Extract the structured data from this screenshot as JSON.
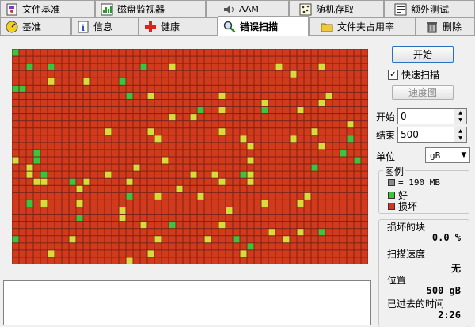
{
  "tabs_row1": [
    {
      "label": "文件基准",
      "icon": "file-benchmark-icon"
    },
    {
      "label": "磁盘监视器",
      "icon": "disk-monitor-icon"
    },
    {
      "label": "AAM",
      "icon": "speaker-icon"
    },
    {
      "label": "随机存取",
      "icon": "random-access-icon"
    },
    {
      "label": "额外测试",
      "icon": "extra-tests-icon"
    }
  ],
  "tabs_row2": [
    {
      "label": "基准",
      "icon": "benchmark-icon"
    },
    {
      "label": "信息",
      "icon": "info-icon"
    },
    {
      "label": "健康",
      "icon": "health-cross-icon"
    },
    {
      "label": "错误扫描",
      "icon": "magnifier-icon",
      "active": true
    },
    {
      "label": "文件夹占用率",
      "icon": "folder-icon"
    },
    {
      "label": "删除",
      "icon": "trash-icon"
    }
  ],
  "controls": {
    "start_label": "开始",
    "quick_scan_label": "快速扫描",
    "quick_scan_checked": true,
    "speed_map_label": "速度图",
    "start_pos_label": "开始",
    "start_pos_value": "0",
    "end_pos_label": "结束",
    "end_pos_value": "500",
    "unit_label": "单位",
    "unit_value": "gB"
  },
  "legend": {
    "title": "图例",
    "block_text": "= 190 MB",
    "good": "好",
    "bad": "损坏"
  },
  "stats": {
    "damaged_blocks_label": "损坏的块",
    "damaged_blocks_value": "0.0 %",
    "scan_speed_label": "扫描速度",
    "scan_speed_value": "无",
    "position_label": "位置",
    "position_value": "500 gB",
    "elapsed_label": "已过去的时间",
    "elapsed_value": "2:26"
  },
  "grid": {
    "cols": 50,
    "rows": 30,
    "colors": {
      "bad": "#d23a1c",
      "bad_border": "#8c1f0f",
      "good": "#3cc43c",
      "warn": "#d8dc3a",
      "border": "#7b2318"
    }
  }
}
